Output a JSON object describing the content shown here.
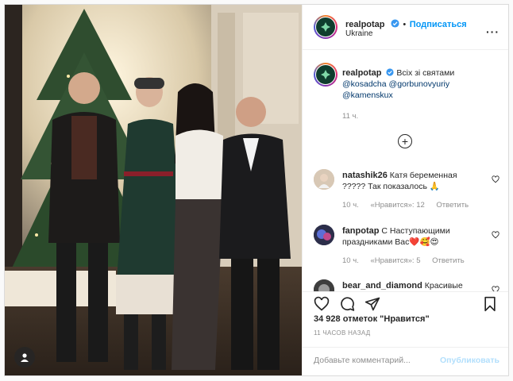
{
  "post": {
    "author": {
      "username": "realpotap",
      "verified": true,
      "follow_label": "Подписаться",
      "location": "Ukraine",
      "avatar_icon": "leaf-logo-icon"
    },
    "caption": {
      "username": "realpotap",
      "text": "Всіх зі святами",
      "mentions": [
        "@kosadcha",
        "@gorbunovyuriy",
        "@kamenskux"
      ],
      "time": "11 ч."
    },
    "load_more_icon": "plus-circle-icon",
    "comments": [
      {
        "username": "natashik26",
        "text_line1": "Катя беременная",
        "text_line2": "????? Так показалось 🙏",
        "time": "10 ч.",
        "likes": "«Нравится»: 12",
        "reply": "Ответить"
      },
      {
        "username": "fanpotap",
        "text_line1": "С Наступающими",
        "text_line2": "праздниками Вас❤️🥰😍",
        "time": "10 ч.",
        "likes": "«Нравится»: 5",
        "reply": "Ответить"
      },
      {
        "username": "bear_and_diamond",
        "text_line1": "Красивые",
        "text_line2": "",
        "time": "",
        "likes": "",
        "reply": ""
      }
    ],
    "likes_count": "34 928 отметок \"Нравится\"",
    "posted_ago": "11 ЧАСОВ НАЗАД",
    "comment_input": {
      "placeholder": "Добавьте комментарий...",
      "publish_label": "Опубликовать"
    },
    "colors": {
      "accent": "#0095f6",
      "verified": "#3897f0",
      "muted": "#8e8e8e",
      "publish_disabled": "#b2dffc"
    }
  }
}
